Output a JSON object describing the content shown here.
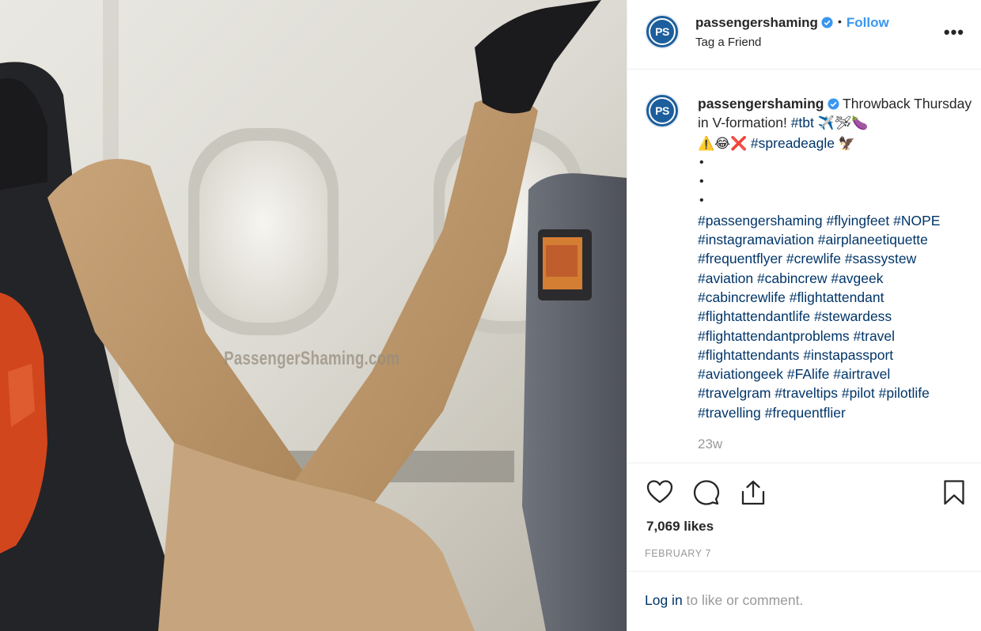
{
  "post": {
    "image_watermark": "PassengerShaming.com"
  },
  "header": {
    "username": "passengershaming",
    "avatar_text": "PS",
    "separator": "•",
    "follow_label": "Follow",
    "subtitle": "Tag a Friend",
    "more_label": "•••"
  },
  "caption": {
    "username": "passengershaming",
    "avatar_text": "PS",
    "text_1": "Throwback Thursday in V-formation! ",
    "tag_tbt": "#tbt",
    "emoji_1": " ✈️🛩🍆",
    "emoji_2": "⚠️😂❌ ",
    "tag_spreadeagle": "#spreadeagle",
    "emoji_3": " 🦅",
    "bullets": [
      "•",
      "•",
      "•"
    ],
    "hashtags": [
      "#passengershaming",
      "#flyingfeet",
      "#NOPE",
      "#instagramaviation",
      "#airplaneetiquette",
      "#frequentflyer",
      "#crewlife",
      "#sassystew",
      "#aviation",
      "#cabincrew",
      "#avgeek",
      "#cabincrewlife",
      "#flightattendant",
      "#flightattendantlife",
      "#stewardess",
      "#flightattendantproblems",
      "#travel",
      "#flightattendants",
      "#instapassport",
      "#aviationgeek",
      "#FAlife",
      "#airtravel",
      "#travelgram",
      "#traveltips",
      "#pilot",
      "#pilotlife",
      "#travelling",
      "#frequentflier"
    ],
    "age": "23w"
  },
  "actions": {
    "likes": "7,069 likes",
    "date": "FEBRUARY 7"
  },
  "footer": {
    "login_link": "Log in",
    "login_text": " to like or comment."
  },
  "colors": {
    "link_blue": "#003569",
    "follow_blue": "#3897f0",
    "verified_blue": "#3897f0",
    "muted_gray": "#999999",
    "brand_navy": "#1d5e9c"
  },
  "icons": [
    "heart-icon",
    "comment-icon",
    "share-icon",
    "bookmark-icon",
    "verified-badge-icon",
    "more-options-icon"
  ]
}
